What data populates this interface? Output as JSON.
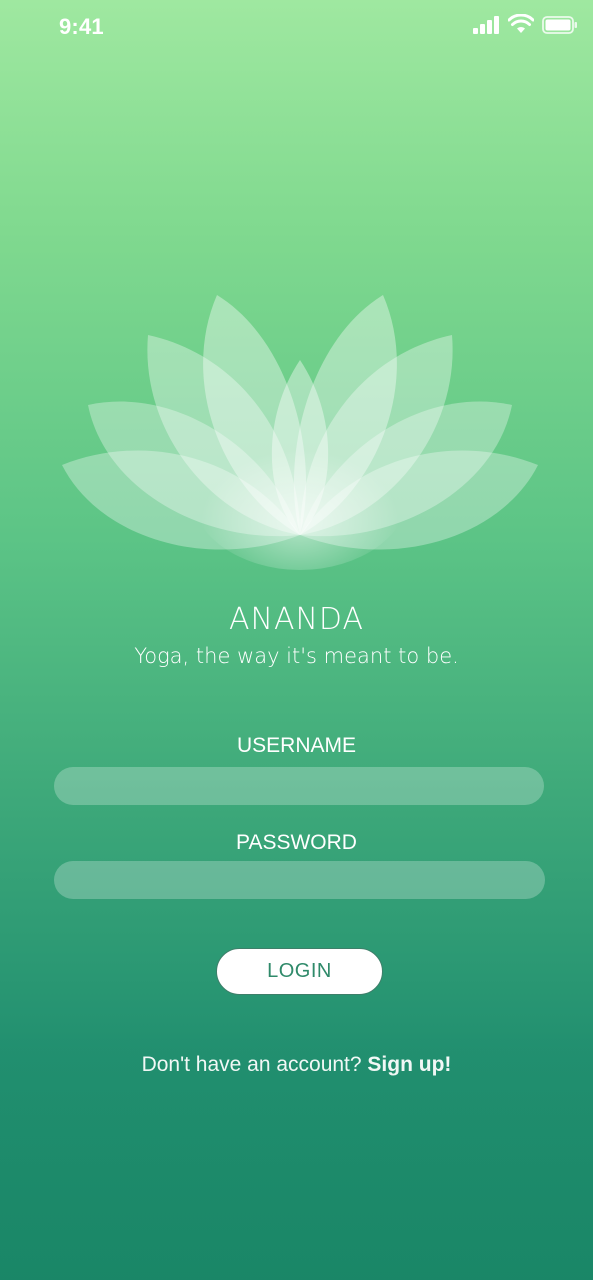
{
  "status_bar": {
    "time": "9:41",
    "icons": [
      "signal-icon",
      "wifi-icon",
      "battery-icon"
    ]
  },
  "brand": {
    "logo": "lotus-icon",
    "name": "ANANDA",
    "tagline": "Yoga, the way it's meant to be."
  },
  "form": {
    "username_label": "USERNAME",
    "username_value": "",
    "password_label": "PASSWORD",
    "password_value": "",
    "login_label": "LOGIN"
  },
  "signup": {
    "prompt": "Don't have an account?",
    "link_label": "Sign up!"
  },
  "colors": {
    "gradient_top": "#9fe8a0",
    "gradient_bottom": "#1c8a6b",
    "button_text": "#2f8a6a",
    "text": "#ffffff"
  }
}
